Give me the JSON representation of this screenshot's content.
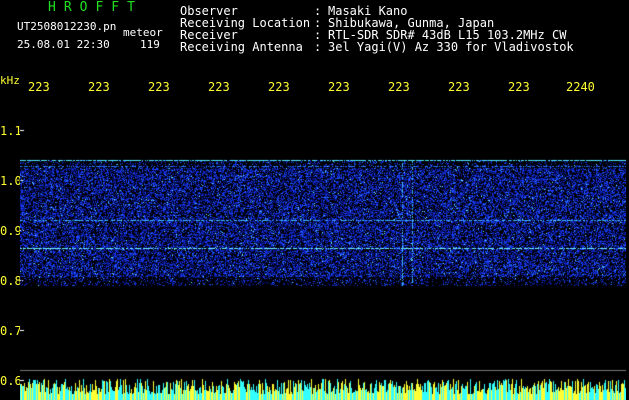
{
  "header": {
    "brand": "HROFFT",
    "filename": "UT2508012230.pn",
    "tag": "meteor",
    "datetime": "25.08.01 22:30",
    "count": "119"
  },
  "info": [
    {
      "label": "Observer",
      "value": "Masaki Kano"
    },
    {
      "label": "Receiving Location",
      "value": "Shibukawa, Gunma, Japan"
    },
    {
      "label": "Receiver",
      "value": "RTL-SDR SDR# 43dB L15 103.2MHz CW"
    },
    {
      "label": "Receiving Antenna",
      "value": "3el Yagi(V) Az 330 for Vladivostok"
    }
  ],
  "axis": {
    "unit": "kHz",
    "time_ticks": [
      "223",
      "223",
      "223",
      "223",
      "223",
      "223",
      "223",
      "223",
      "223",
      "2240"
    ],
    "freq_ticks": [
      "1.1",
      "1.0",
      "0.9",
      "0.8",
      "0.7",
      "0.6"
    ]
  },
  "colors": {
    "background": "#000000",
    "header_green": "#1fe01f",
    "header_white": "#ffffff",
    "axis_yellow": "#ffff33",
    "spectrum_blue": "#1a3cff",
    "spectrum_cyan": "#4fe8ff"
  }
}
